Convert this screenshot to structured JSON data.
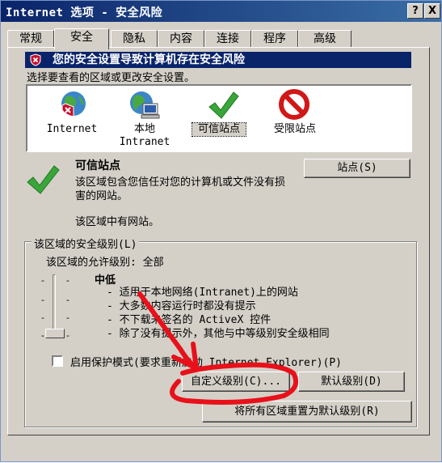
{
  "window": {
    "title": "Internet 选项 - 安全风险",
    "help_button": "?",
    "close_button": "X"
  },
  "tabs": [
    {
      "label": "常规",
      "active": false
    },
    {
      "label": "安全",
      "active": true
    },
    {
      "label": "隐私",
      "active": false
    },
    {
      "label": "内容",
      "active": false
    },
    {
      "label": "连接",
      "active": false
    },
    {
      "label": "程序",
      "active": false
    },
    {
      "label": "高级",
      "active": false
    }
  ],
  "warning": {
    "text": "您的安全设置导致计算机存在安全风险"
  },
  "instructions": "选择要查看的区域或更改安全设置。",
  "zones": [
    {
      "label_line1": "Internet",
      "label_line2": "",
      "icon": "globe-warning-icon",
      "selected": false
    },
    {
      "label_line1": "本地",
      "label_line2": "Intranet",
      "icon": "globe-computer-icon",
      "selected": false
    },
    {
      "label_line1": "可信站点",
      "label_line2": "",
      "icon": "checkmark-icon",
      "selected": true
    },
    {
      "label_line1": "受限站点",
      "label_line2": "",
      "icon": "restricted-icon",
      "selected": false
    }
  ],
  "selected_zone": {
    "name": "可信站点",
    "description": "该区域包含您信任对您的计算机或文件没有损害的网站。",
    "note": "该区域中有网站。",
    "sites_button": "站点(S)"
  },
  "security_level": {
    "group_label": "该区域的安全级别(L)",
    "allowed": "该区域的允许级别: 全部",
    "level_name": "中低",
    "level_fraction": 0.25,
    "bullets": [
      "- 适用于本地网络(Intranet)上的网站",
      "- 大多数内容运行时都没有提示",
      "- 不下载未签名的 ActiveX 控件",
      "- 除了没有提示外，其他与中等级别安全级相同"
    ]
  },
  "protected_mode": {
    "label": "启用保护模式(要求重新启动 Internet Explorer)(P)",
    "checked": false
  },
  "buttons": {
    "custom_level": "自定义级别(C)...",
    "default_level": "默认级别(D)",
    "reset_all": "将所有区域重置为默认级别(R)"
  },
  "colors": {
    "titlebar": "#0a246a",
    "warning_bg": "#0a246a",
    "annotation": "#e8101a",
    "face": "#d4d0c8"
  }
}
